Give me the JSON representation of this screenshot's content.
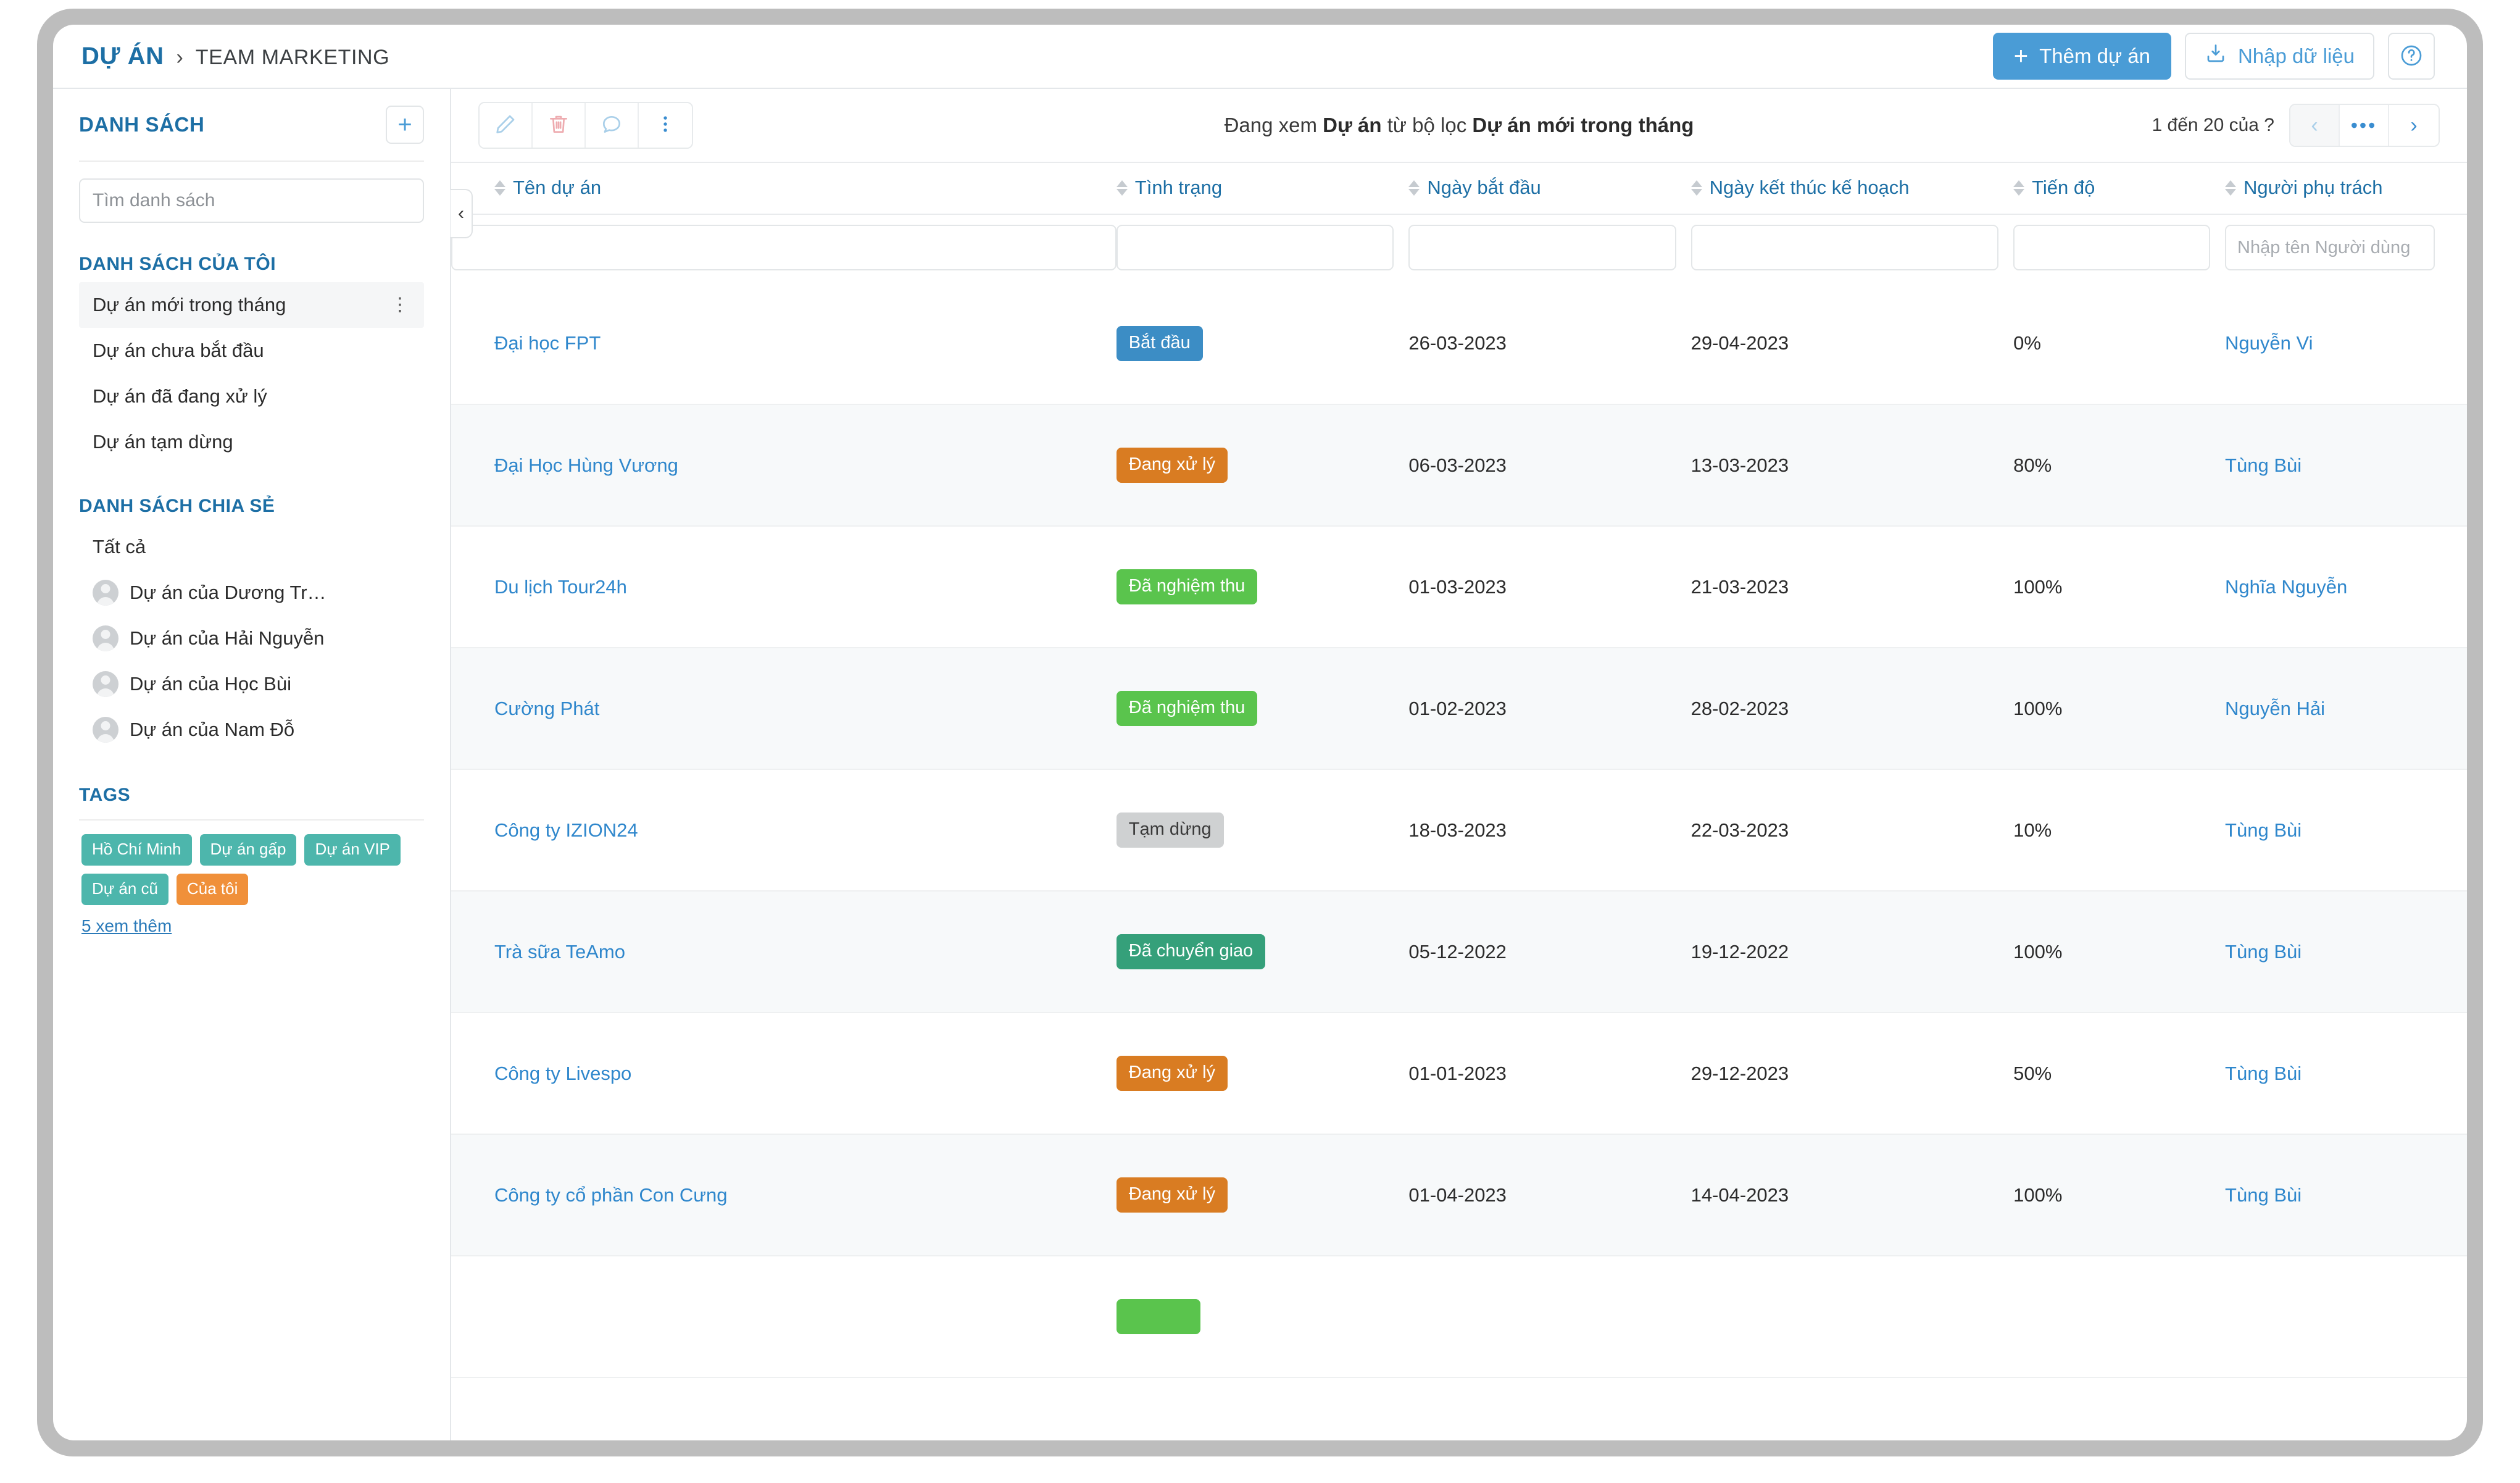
{
  "header": {
    "breadcrumb_root": "DỰ ÁN",
    "breadcrumb_sep": "›",
    "breadcrumb_leaf": "TEAM MARKETING",
    "add_project_label": "Thêm dự án",
    "add_project_plus": "+",
    "import_label": "Nhập dữ liệu",
    "help_label": "?"
  },
  "sidebar": {
    "title": "DANH SÁCH",
    "add_plus": "+",
    "search_placeholder": "Tìm danh sách",
    "search_value": "",
    "my_lists_title": "DANH SÁCH CỦA TÔI",
    "my_lists": [
      {
        "label": "Dự án mới trong tháng",
        "active": true,
        "dots": "⋮"
      },
      {
        "label": "Dự án chưa bắt đầu",
        "active": false
      },
      {
        "label": "Dự án đã đang xử lý",
        "active": false
      },
      {
        "label": "Dự án tạm dừng",
        "active": false
      }
    ],
    "shared_title": "DANH SÁCH CHIA SẺ",
    "shared_lists": [
      {
        "label": "Tất cả",
        "avatar": false
      },
      {
        "label": "Dự án của Dương Tr…",
        "avatar": true
      },
      {
        "label": "Dự án của Hải Nguyễn",
        "avatar": true
      },
      {
        "label": "Dự án của Học Bùi",
        "avatar": true
      },
      {
        "label": "Dự án của Nam Đỗ",
        "avatar": true
      }
    ],
    "tags_title": "TAGS",
    "tags": [
      {
        "label": "Hồ Chí Minh",
        "color": "#4db6ac"
      },
      {
        "label": "Dự án gấp",
        "color": "#4db6ac"
      },
      {
        "label": "Dự án VIP",
        "color": "#4db6ac"
      },
      {
        "label": "Dự án cũ",
        "color": "#4db6ac"
      },
      {
        "label": "Của tôi",
        "color": "#f0903a"
      }
    ],
    "more_tags_label": "5  xem thêm"
  },
  "main": {
    "collapse_glyph": "‹",
    "toolbar_icons": [
      "pencil-icon",
      "trash-icon",
      "comment-icon",
      "more-vertical-icon"
    ],
    "view_title_prefix": "Đang xem ",
    "view_title_obj": "Dự án",
    "view_title_mid": " từ bộ lọc ",
    "view_title_filter": "Dự án mới trong tháng",
    "pager_text": "1 đến 20 của  ?",
    "pager_prev": "‹",
    "pager_dots": "•••",
    "pager_next": "›",
    "columns": [
      {
        "label": "Tên dự án",
        "filter_placeholder": ""
      },
      {
        "label": "Tình trạng",
        "filter_placeholder": ""
      },
      {
        "label": "Ngày bắt đầu",
        "filter_placeholder": ""
      },
      {
        "label": "Ngày kết thúc kế hoạch",
        "filter_placeholder": ""
      },
      {
        "label": "Tiến độ",
        "filter_placeholder": ""
      },
      {
        "label": "Người phụ trách",
        "filter_placeholder": "Nhập tên Người dùng"
      }
    ],
    "rows": [
      {
        "name": "Đại học FPT",
        "status": "Bắt đầu",
        "status_color": "#3c8dc5",
        "start": "26-03-2023",
        "end": "29-04-2023",
        "progress": "0%",
        "owner": "Nguyễn Vi"
      },
      {
        "name": "Đại Học Hùng Vương",
        "status": "Đang xử lý",
        "status_color": "#d97c22",
        "start": "06-03-2023",
        "end": "13-03-2023",
        "progress": "80%",
        "owner": "Tùng Bùi"
      },
      {
        "name": "Du lịch Tour24h",
        "status": "Đã nghiệm thu",
        "status_color": "#5cc council",
        "start": "01-03-2023",
        "end": "21-03-2023",
        "progress": "100%",
        "owner": "Nghĩa Nguyễn"
      },
      {
        "name": "Cường Phát",
        "status": "Đã nghiệm thu",
        "status_color": "#5cc council",
        "start": "01-02-2023",
        "end": "28-02-2023",
        "progress": "100%",
        "owner": "Nguyễn Hải"
      },
      {
        "name": "Công ty IZION24",
        "status": "Tạm dừng",
        "status_color": "#cfd1d2",
        "start": "18-03-2023",
        "end": "22-03-2023",
        "progress": "10%",
        "owner": "Tùng Bùi"
      },
      {
        "name": "Trà sữa TeAmo",
        "status": "Đã chuyển giao",
        "status_color": "#35a07a",
        "start": "05-12-2022",
        "end": "19-12-2022",
        "progress": "100%",
        "owner": "Tùng Bùi"
      },
      {
        "name": "Công ty Livespo",
        "status": "Đang xử lý",
        "status_color": "#d97c22",
        "start": "01-01-2023",
        "end": "29-12-2023",
        "progress": "50%",
        "owner": "Tùng Bùi"
      },
      {
        "name": "Công ty cổ phần Con Cưng",
        "status": "Đang xử lý",
        "status_color": "#d97c22",
        "start": "01-04-2023",
        "end": "14-04-2023",
        "progress": "100%",
        "owner": "Tùng Bùi"
      },
      {
        "name": "",
        "status": "",
        "status_color": "#5cc council",
        "start": "",
        "end": "",
        "progress": "",
        "owner": ""
      }
    ]
  }
}
